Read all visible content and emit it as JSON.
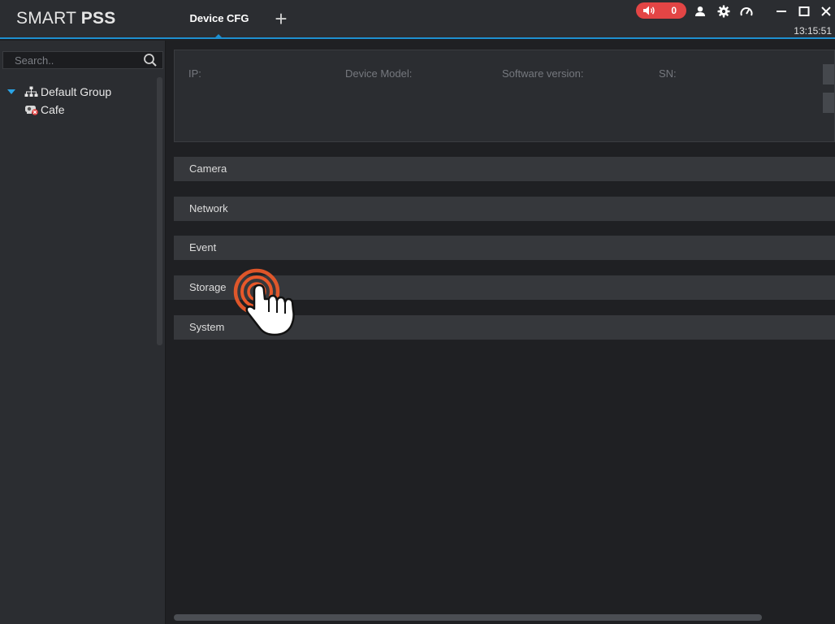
{
  "app": {
    "brand_light": "SMART ",
    "brand_bold": "PSS"
  },
  "tabs": [
    {
      "label": "Device CFG",
      "active": true
    }
  ],
  "add_tab_label": "+",
  "header": {
    "alarm_count": "0",
    "clock": "13:15:51",
    "icons": [
      "speaker-icon",
      "user-icon",
      "gear-icon",
      "speedometer-icon",
      "minimize-icon",
      "maximize-icon",
      "close-icon"
    ]
  },
  "sidebar": {
    "search_placeholder": "Search..",
    "tree": [
      {
        "label": "Default Group",
        "type": "group",
        "expanded": true
      },
      {
        "label": "Cafe",
        "type": "device",
        "status": "offline"
      }
    ]
  },
  "device_info": {
    "ip_label": "IP:",
    "model_label": "Device Model:",
    "software_label": "Software version:",
    "sn_label": "SN:"
  },
  "sections": [
    {
      "label": "Camera"
    },
    {
      "label": "Network"
    },
    {
      "label": "Event"
    },
    {
      "label": "Storage"
    },
    {
      "label": "System"
    }
  ],
  "colors": {
    "accent": "#1e8fd0",
    "alarm": "#e34545",
    "panel": "#2b2d31",
    "background": "#1f2023",
    "section": "#36383c",
    "cursor_ring": "#e8582a"
  }
}
